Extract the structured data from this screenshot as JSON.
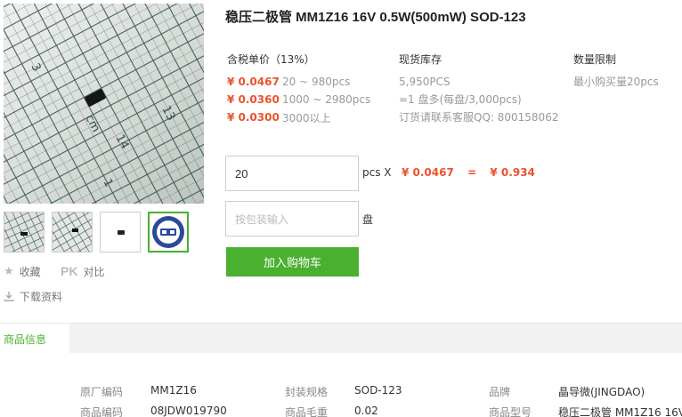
{
  "product": {
    "title": "稳压二极管 MM1Z16 16V 0.5W(500mW) SOD-123"
  },
  "gallery": {
    "thumbnails": [
      "thumb-1",
      "thumb-2",
      "thumb-3",
      "thumb-4"
    ],
    "ruler_numbers": [
      "3",
      "13",
      "cm",
      "14",
      "1"
    ]
  },
  "actions": {
    "favorite": "收藏",
    "pk_badge": "PK",
    "compare": "对比",
    "download": "下载资料"
  },
  "pricing": {
    "header": "含税单价（13%）",
    "tiers": [
      {
        "price": "¥ 0.0467",
        "range": "20 ~ 980pcs"
      },
      {
        "price": "¥ 0.0360",
        "range": "1000 ~ 2980pcs"
      },
      {
        "price": "¥ 0.0300",
        "range": "3000以上"
      }
    ]
  },
  "stock": {
    "header": "现货库存",
    "lines": [
      "5,950PCS",
      "≈1 盘多(每盘/3,000pcs)",
      "订货请联系客服QQ: 800158062"
    ]
  },
  "limit": {
    "header": "数量限制",
    "text": "最小购买量20pcs"
  },
  "order": {
    "quantity": "20",
    "unit_x": "pcs X",
    "unit_price": "¥ 0.0467",
    "equals": "=",
    "total": "¥ 0.934",
    "pack_placeholder": "按包装输入",
    "pack_unit": "盘",
    "add_to_cart": "加入购物车"
  },
  "info": {
    "tab": "商品信息",
    "specs": [
      {
        "k": "原厂编码",
        "v": "MM1Z16"
      },
      {
        "k": "封装规格",
        "v": "SOD-123"
      },
      {
        "k": "品牌",
        "v": "晶导微(JINGDAO)"
      },
      {
        "k": "商品编码",
        "v": "08JDW019790"
      },
      {
        "k": "商品毛重",
        "v": "0.02"
      },
      {
        "k": "商品型号",
        "v": "稳压二极管 MM1Z16 16V..."
      }
    ]
  },
  "colors": {
    "accent_green": "#49b030",
    "price_red": "#e9532e"
  }
}
